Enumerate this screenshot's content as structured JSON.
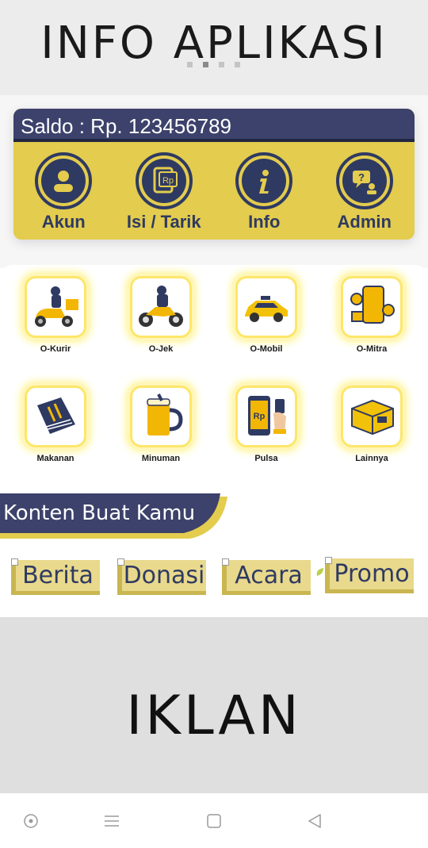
{
  "banner": {
    "title": "INFO APLIKASI",
    "dots": 4,
    "active_dot": 1
  },
  "wallet": {
    "balance_text": "Saldo : Rp. 123456789",
    "items": [
      {
        "label": "Akun",
        "icon": "user-icon"
      },
      {
        "label": "Isi / Tarik",
        "icon": "topup-rp-icon",
        "icon_text": "Rp"
      },
      {
        "label": "Info",
        "icon": "info-icon"
      },
      {
        "label": "Admin",
        "icon": "admin-chat-icon"
      }
    ]
  },
  "services": [
    {
      "label": "O-Kurir",
      "icon": "courier-scooter-icon"
    },
    {
      "label": "O-Jek",
      "icon": "motorbike-icon"
    },
    {
      "label": "O-Mobil",
      "icon": "car-icon"
    },
    {
      "label": "O-Mitra",
      "icon": "partner-phone-icon"
    },
    {
      "label": "Makanan",
      "icon": "menu-cutlery-icon"
    },
    {
      "label": "Minuman",
      "icon": "beer-mug-icon"
    },
    {
      "label": "Pulsa",
      "icon": "phone-credit-icon",
      "icon_text": "Rp"
    },
    {
      "label": "Lainnya",
      "icon": "package-box-icon"
    }
  ],
  "content_section": {
    "title": "Konten Buat Kamu",
    "tabs": [
      "Berita",
      "Donasi",
      "Acara",
      "Promo"
    ]
  },
  "ad": {
    "text": "IKLAN"
  },
  "colors": {
    "navy": "#2f3a62",
    "yellow": "#e3cc4e",
    "light_yellow": "#e8d98c"
  }
}
